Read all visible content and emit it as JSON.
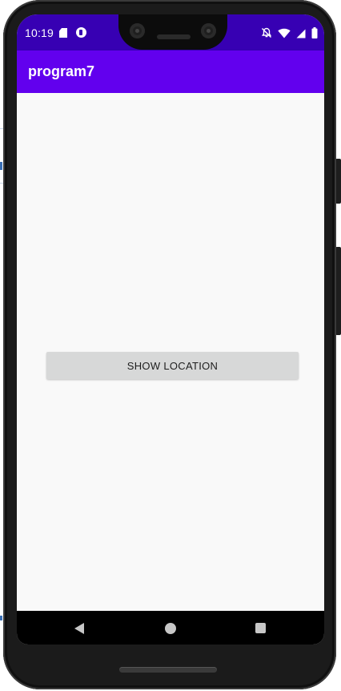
{
  "status_bar": {
    "time": "10:19",
    "background_color": "#3700b3",
    "left_icons": [
      "sd-card-icon",
      "notification-circle-icon"
    ],
    "right_icons": [
      "notifications-off-icon",
      "wifi-icon",
      "signal-icon",
      "battery-icon"
    ]
  },
  "app_bar": {
    "title": "program7",
    "background_color": "#6200ee"
  },
  "main": {
    "show_location_label": "SHOW LOCATION",
    "button_color": "#d7d8d8"
  },
  "nav_bar": {
    "icons": [
      "back-icon",
      "home-icon",
      "recents-icon"
    ]
  }
}
